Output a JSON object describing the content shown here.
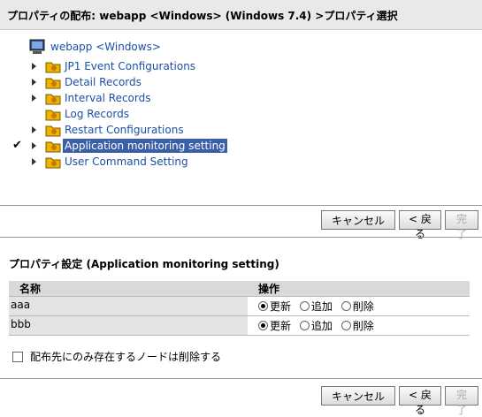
{
  "header": {
    "title": "プロパティの配布: webapp <Windows> (Windows 7.4) >プロパティ選択"
  },
  "tree": {
    "root_label": "webapp <Windows>",
    "items": [
      {
        "label": "JP1 Event Configurations",
        "expandable": true,
        "checked": false,
        "selected": false
      },
      {
        "label": "Detail Records",
        "expandable": true,
        "checked": false,
        "selected": false
      },
      {
        "label": "Interval Records",
        "expandable": true,
        "checked": false,
        "selected": false
      },
      {
        "label": "Log Records",
        "expandable": false,
        "checked": false,
        "selected": false
      },
      {
        "label": "Restart Configurations",
        "expandable": true,
        "checked": false,
        "selected": false
      },
      {
        "label": "Application monitoring setting",
        "expandable": true,
        "checked": true,
        "selected": true
      },
      {
        "label": "User Command Setting",
        "expandable": true,
        "checked": false,
        "selected": false
      }
    ]
  },
  "buttons": {
    "cancel": "キャンセル",
    "back": "< 戻る",
    "done": "完了"
  },
  "check_mark": "✔",
  "settings": {
    "title": "プロパティ設定 (Application monitoring setting)",
    "columns": {
      "name": "名称",
      "ops": "操作"
    },
    "option_labels": {
      "update": "更新",
      "add": "追加",
      "delete": "削除"
    },
    "rows": [
      {
        "name": "aaa",
        "selected_op": "update"
      },
      {
        "name": "bbb",
        "selected_op": "update"
      }
    ],
    "checkbox_label": "配布先にのみ存在するノードは削除する"
  },
  "colors": {
    "link": "#1c4fa6",
    "selection": "#3a5fa8",
    "header_bg": "#e9e9e9"
  }
}
